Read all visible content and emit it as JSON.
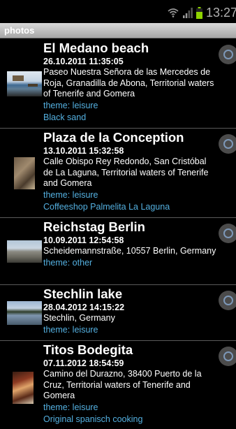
{
  "status_bar": {
    "time": "13:27",
    "icons": [
      "wifi-icon",
      "signal-icon",
      "battery-icon"
    ]
  },
  "header": {
    "title": "photos"
  },
  "items": [
    {
      "name": "El Medano beach",
      "date": "26.10.2011 11:35:05",
      "address": "Paseo Nuestra Señora de las Mercedes de Roja, Granadilla de Abona, Territorial waters of Tenerife and Gomera",
      "theme": "theme: leisure",
      "note": "Black sand"
    },
    {
      "name": "Plaza de la Conception",
      "date": "13.10.2011 15:32:58",
      "address": "Calle Obispo Rey Redondo, San Cristóbal de La Laguna, Territorial waters of Tenerife and Gomera",
      "theme": "theme: leisure",
      "note": "Coffeeshop Palmelita La Laguna"
    },
    {
      "name": "Reichstag Berlin",
      "date": "10.09.2011 12:54:58",
      "address": "Scheidemannstraße, 10557 Berlin, Germany",
      "theme": "theme: other",
      "note": ""
    },
    {
      "name": "Stechlin lake",
      "date": "28.04.2012 14:15:22",
      "address": "Stechlin, Germany",
      "theme": "theme: leisure",
      "note": ""
    },
    {
      "name": "Titos Bodegita",
      "date": "07.11.2012 18:54:59",
      "address": "Camino del Durazno, 38400 Puerto de la Cruz, Territorial waters of Tenerife and Gomera",
      "theme": "theme: leisure",
      "note": "Original spanisch cooking"
    }
  ],
  "colors": {
    "accent": "#54b0e0",
    "background": "#000000",
    "title_bar": "#b8b8b8"
  }
}
